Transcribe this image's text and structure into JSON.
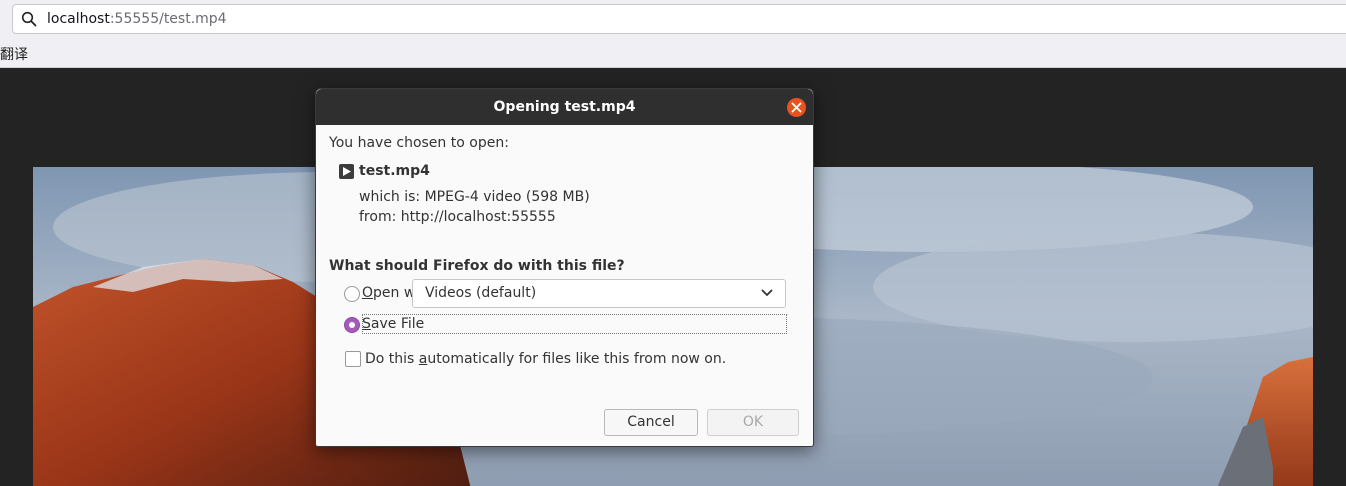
{
  "browser": {
    "url_host": "localhost",
    "url_rest": ":55555/test.mp4",
    "bookmark_label": "翻译"
  },
  "dialog": {
    "title": "Opening test.mp4",
    "intro": "You have chosen to open:",
    "file_name": "test.mp4",
    "which_is_label": "which is:",
    "which_is_value": "MPEG-4 video (598 MB)",
    "from_label": "from:",
    "from_value": "http://localhost:55555",
    "question": "What should Firefox do with this file?",
    "open_with_label_first": "O",
    "open_with_label_rest": "pen with",
    "open_with_app": "Videos (default)",
    "save_file_label_first": "S",
    "save_file_label_rest": "ave File",
    "auto_label_pre": "Do this ",
    "auto_label_ul": "a",
    "auto_label_post": "utomatically for files like this from now on.",
    "cancel_label": "Cancel",
    "ok_label": "OK",
    "selected_option": "save-file"
  },
  "colors": {
    "close_button": "#e9531f",
    "radio_checked": "#a35bb9",
    "titlebar": "#2f2f2f"
  }
}
